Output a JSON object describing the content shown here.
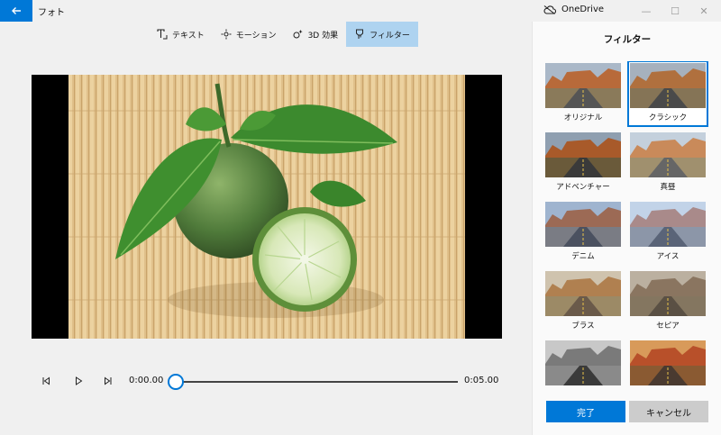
{
  "window": {
    "app_title": "フォト",
    "onedrive_label": "OneDrive",
    "minimize": "—",
    "maximize": "☐",
    "close": "✕"
  },
  "toolbar": {
    "items": [
      {
        "label": "テキスト",
        "icon": "text-icon"
      },
      {
        "label": "モーション",
        "icon": "motion-icon"
      },
      {
        "label": "3D 効果",
        "icon": "effects-icon"
      },
      {
        "label": "フィルター",
        "icon": "filter-icon",
        "active": true
      }
    ]
  },
  "playback": {
    "current_time": "0:00.00",
    "total_time": "0:05.00",
    "progress": 0
  },
  "panel": {
    "title": "フィルター",
    "filters": [
      {
        "label": "オリジナル",
        "style": "original"
      },
      {
        "label": "クラシック",
        "style": "classic",
        "selected": true
      },
      {
        "label": "アドベンチャー",
        "style": "adventure"
      },
      {
        "label": "真昼",
        "style": "noon"
      },
      {
        "label": "デニム",
        "style": "denim"
      },
      {
        "label": "アイス",
        "style": "ice"
      },
      {
        "label": "ブラス",
        "style": "brass"
      },
      {
        "label": "セピア",
        "style": "sepia"
      },
      {
        "label": "",
        "style": "bw"
      },
      {
        "label": "",
        "style": "warm"
      }
    ],
    "done_label": "完了",
    "cancel_label": "キャンセル"
  },
  "colors": {
    "accent": "#0078d7",
    "active_tool": "#aed3f0"
  }
}
